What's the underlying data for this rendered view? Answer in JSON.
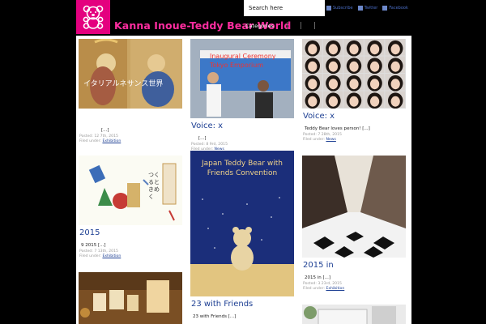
{
  "header": {
    "site_title": "Kanna Inoue-Teddy Bear World",
    "logo_icon": "teddy-bear-icon",
    "search_placeholder": "Search here",
    "feeds": [
      "Subscribe",
      "Twitter",
      "Facebook"
    ],
    "menu_categories": "Categories"
  },
  "colors": {
    "logo_bg": "#e4007f",
    "title": "#ff2da0",
    "link": "#1d3f93",
    "meta": "#9a9a9a"
  },
  "posts": [
    {
      "title": "",
      "excerpt": "[...]",
      "date": "Posted: 12 7th, 2015",
      "category": "Exhibition",
      "thumb_text": "イタリアルネサンス世界"
    },
    {
      "title": "2015",
      "excerpt": "9 2015 [...]",
      "date": "Posted: 7 13th, 2015",
      "category": "Exhibition",
      "thumb_text": "つくるときめく"
    },
    {
      "title": "",
      "excerpt": "",
      "date": "",
      "category": "",
      "thumb_text": ""
    },
    {
      "title": "Voice: x",
      "excerpt": "[...]",
      "date": "Posted: 8 9rd, 2015",
      "category": "News",
      "thumb_text": "Inaugural Ceremony Tokyo Emporium"
    },
    {
      "title": "23 with Friends",
      "excerpt": "23 with Friends [...]",
      "date": "",
      "category": "",
      "thumb_text": "Japan Teddy Bear with Friends Convention"
    },
    {
      "title": "Voice: x",
      "excerpt": "Teddy Bear loves person! [...]",
      "date": "Posted: 7 28th, 2015",
      "category": "News",
      "thumb_text": ""
    },
    {
      "title": "2015 in",
      "excerpt": "2015 in [...]",
      "date": "Posted: 3 23rd, 2015",
      "category": "Exhibition",
      "thumb_text": ""
    },
    {
      "title": "",
      "excerpt": "",
      "date": "",
      "category": "",
      "thumb_text": ""
    }
  ],
  "filed_under": "Filed under:"
}
